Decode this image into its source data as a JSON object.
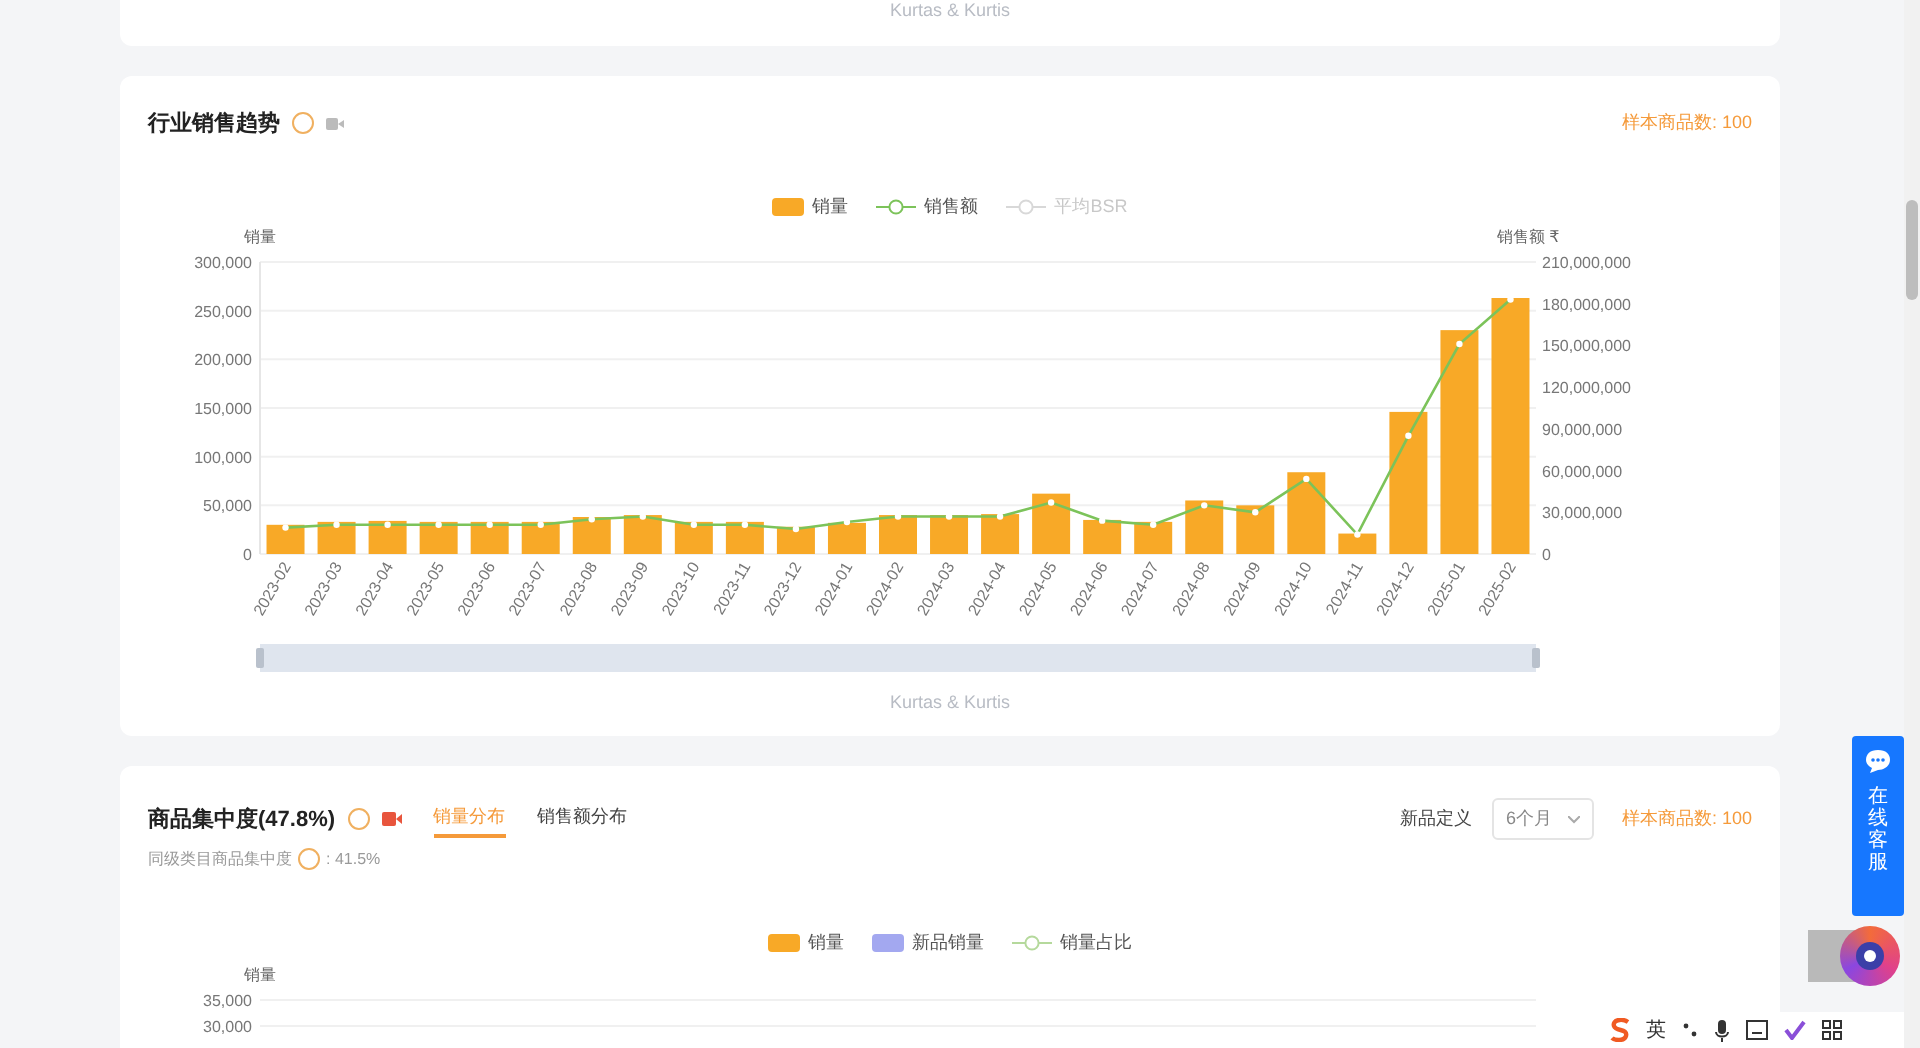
{
  "top_card": {
    "caption": "Kurtas & Kurtis"
  },
  "trend_card": {
    "title": "行业销售趋势",
    "sample_count": "样本商品数: 100",
    "extra_legend": [
      {
        "label": "平均BSR",
        "active": false
      }
    ],
    "left_axis_title": "销量",
    "right_axis_title": "销售额 ₹",
    "chart_data": {
      "type": "bar",
      "categories": [
        "2023-02",
        "2023-03",
        "2023-04",
        "2023-05",
        "2023-06",
        "2023-07",
        "2023-08",
        "2023-09",
        "2023-10",
        "2023-11",
        "2023-12",
        "2024-01",
        "2024-02",
        "2024-03",
        "2024-04",
        "2024-05",
        "2024-06",
        "2024-07",
        "2024-08",
        "2024-09",
        "2024-10",
        "2024-11",
        "2024-12",
        "2025-01",
        "2025-02"
      ],
      "series": [
        {
          "name": "销量",
          "color": "#f8a927",
          "values": [
            30000,
            33000,
            34000,
            33000,
            33000,
            33000,
            38000,
            40000,
            33000,
            33000,
            28000,
            32000,
            40000,
            40000,
            41000,
            62000,
            35000,
            33000,
            55000,
            50000,
            84000,
            21000,
            146000,
            230000,
            263000
          ]
        }
      ],
      "grid": true,
      "ylim": [
        0,
        300000
      ],
      "yticks": [
        {
          "value": 0,
          "label": "0"
        },
        {
          "value": 50000,
          "label": "50,000"
        },
        {
          "value": 100000,
          "label": "100,000"
        },
        {
          "value": 150000,
          "label": "150,000"
        },
        {
          "value": 200000,
          "label": "200,000"
        },
        {
          "value": 250000,
          "label": "250,000"
        },
        {
          "value": 300000,
          "label": "300,000"
        }
      ]
    },
    "amount_chart": {
      "chart_data": {
        "type": "line",
        "series": [
          {
            "name": "销售额",
            "color": "#7cc35a",
            "marker": true,
            "values": [
              19000000,
              21000000,
              21000000,
              21000000,
              21000000,
              21000000,
              25000000,
              27000000,
              21000000,
              21000000,
              18000000,
              23000000,
              27000000,
              27000000,
              27000000,
              37000000,
              24000000,
              21000000,
              35000000,
              30000000,
              54000000,
              14000000,
              85000000,
              151000000,
              183000000
            ]
          }
        ],
        "ylim": [
          0,
          210000000
        ],
        "yticks": [
          {
            "value": 0,
            "label": "0"
          },
          {
            "value": 30000000,
            "label": "30,000,000"
          },
          {
            "value": 60000000,
            "label": "60,000,000"
          },
          {
            "value": 90000000,
            "label": "90,000,000"
          },
          {
            "value": 120000000,
            "label": "120,000,000"
          },
          {
            "value": 150000000,
            "label": "150,000,000"
          },
          {
            "value": 180000000,
            "label": "180,000,000"
          },
          {
            "value": 210000000,
            "label": "210,000,000"
          }
        ]
      }
    },
    "zoom_slider": {
      "level": 1
    },
    "caption": "Kurtas & Kurtis"
  },
  "concentration_card": {
    "title": "商品集中度(47.8%)",
    "tabs": [
      {
        "label": "销量分布",
        "selected": true
      },
      {
        "label": "销售额分布",
        "selected": false
      }
    ],
    "peer_label": "同级类目商品集中度",
    "peer_value": ": 41.5%",
    "new_definition_label": "新品定义",
    "new_definition_select": "6个月",
    "sample_count": "样本商品数: 100",
    "legend": [
      {
        "label": "销量",
        "kind": "bar",
        "color": "#f8a927"
      },
      {
        "label": "新品销量",
        "kind": "bar",
        "color": "#a3a8f0"
      },
      {
        "label": "销量占比",
        "kind": "line",
        "color": "#b5d99c"
      }
    ],
    "left_axis_title": "销量",
    "y_ticks": [
      "35,000",
      "30,000"
    ]
  },
  "support_button": {
    "label": "在线客服"
  },
  "ime_bar": {
    "language": "英"
  }
}
